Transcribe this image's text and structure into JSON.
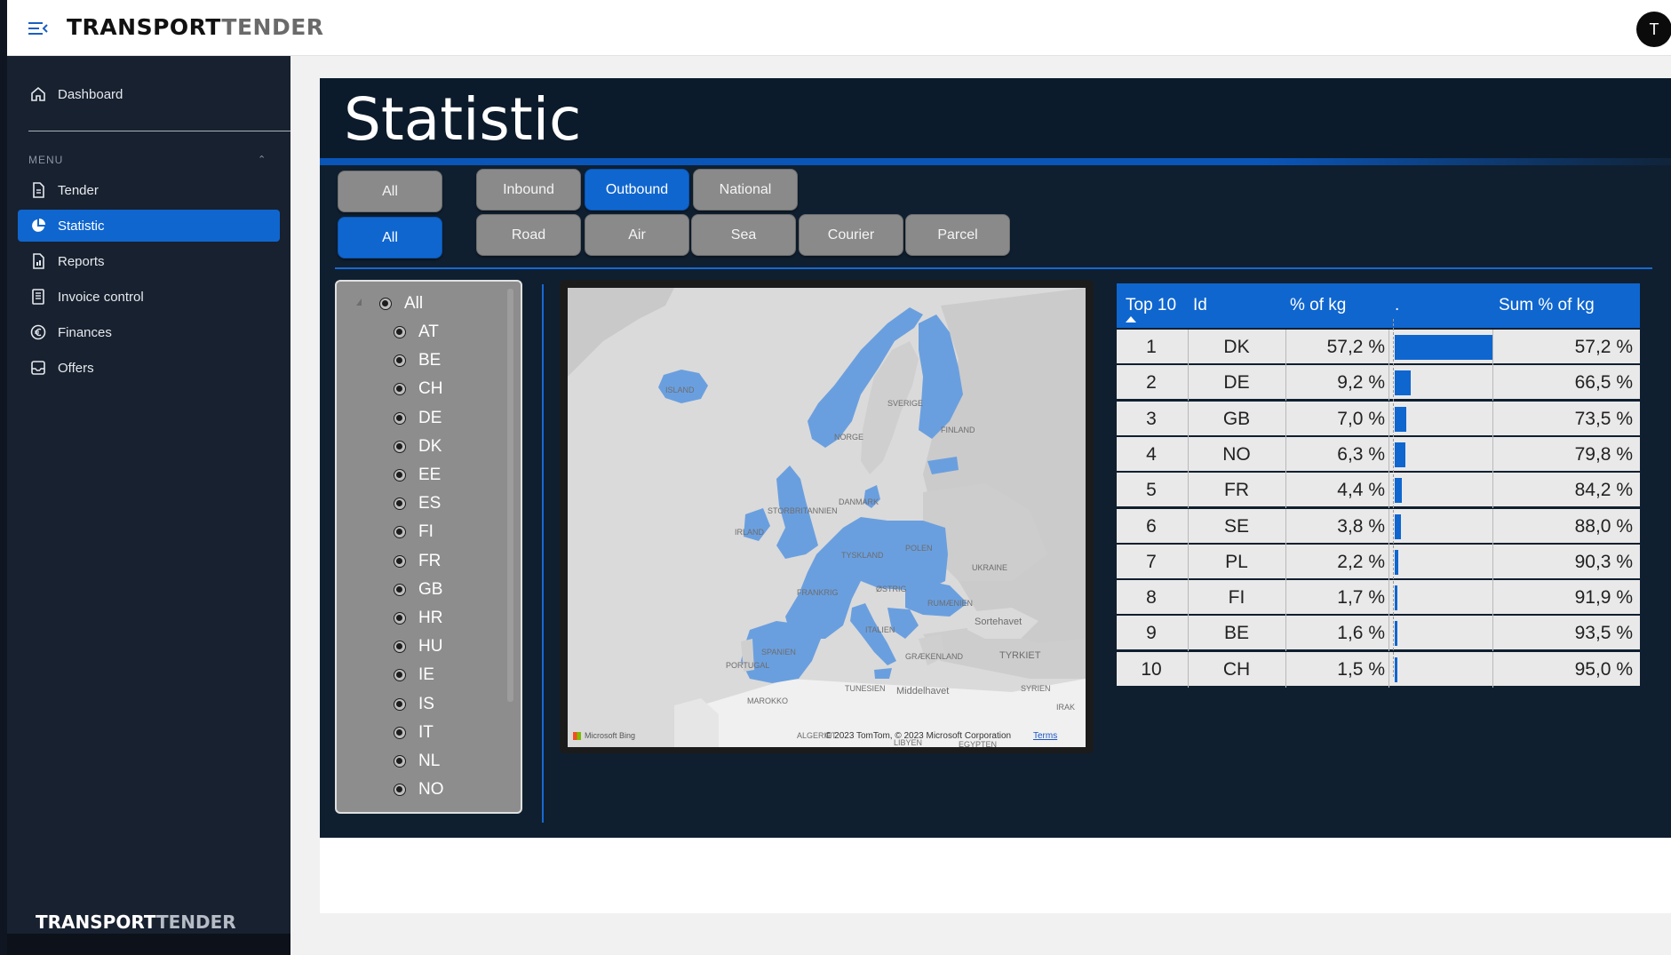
{
  "header": {
    "logo_part1": "TRANSPORT",
    "logo_part2": "TENDER",
    "avatar_initial": "T"
  },
  "sidebar": {
    "dashboard_label": "Dashboard",
    "menu_section_label": "MENU",
    "items": [
      {
        "label": "Tender",
        "icon": "document-icon"
      },
      {
        "label": "Statistic",
        "icon": "pie-chart-icon",
        "active": true
      },
      {
        "label": "Reports",
        "icon": "report-icon"
      },
      {
        "label": "Invoice control",
        "icon": "invoice-icon"
      },
      {
        "label": "Finances",
        "icon": "euro-icon"
      },
      {
        "label": "Offers",
        "icon": "inbox-icon"
      }
    ],
    "footer_logo_part1": "TRANSPORT",
    "footer_logo_part2": "TENDER"
  },
  "report": {
    "title": "Statistic",
    "filters_row1": {
      "all_label": "All",
      "buttons": [
        "Inbound",
        "Outbound",
        "National"
      ],
      "active": "Outbound"
    },
    "filters_row2": {
      "all_label": "All",
      "all_active": true,
      "buttons": [
        "Road",
        "Air",
        "Sea",
        "Courier",
        "Parcel"
      ]
    },
    "slicer": {
      "all_label": "All",
      "countries": [
        "AT",
        "BE",
        "CH",
        "DE",
        "DK",
        "EE",
        "ES",
        "FI",
        "FR",
        "GB",
        "HR",
        "HU",
        "IE",
        "IS",
        "IT",
        "NL",
        "NO"
      ]
    },
    "map": {
      "labels": [
        "ISLAND",
        "SVERIGE",
        "NORGE",
        "FINLAND",
        "STORBRITANNIEN",
        "DANMARK",
        "IRLAND",
        "POLEN",
        "TYSKLAND",
        "UKRAINE",
        "FRANKRIG",
        "ØSTRIG",
        "RUMÆNIEN",
        "Sortehavet",
        "ITALIEN",
        "SPANIEN",
        "PORTUGAL",
        "GRÆKENLAND",
        "TYRKIET",
        "SYRIEN",
        "TUNESIEN",
        "Middelhavet",
        "MAROKKO",
        "IRAK",
        "ALGERIET",
        "LIBYEN",
        "EGYPTEN"
      ],
      "bing_label": "Microsoft Bing",
      "copyright": "© 2023 TomTom, © 2023 Microsoft Corporation",
      "terms_label": "Terms",
      "highlight_color": "#6a9fdf"
    },
    "table": {
      "headers": {
        "top": "Top 10",
        "id": "Id",
        "pct": "% of kg",
        "bar": ".",
        "sum": "Sum % of kg"
      },
      "rows": [
        {
          "rank": "1",
          "id": "DK",
          "pct": "57,2 %",
          "pct_value": 57.2,
          "sum": "57,2 %"
        },
        {
          "rank": "2",
          "id": "DE",
          "pct": "9,2 %",
          "pct_value": 9.2,
          "sum": "66,5 %"
        },
        {
          "rank": "3",
          "id": "GB",
          "pct": "7,0 %",
          "pct_value": 7.0,
          "sum": "73,5 %"
        },
        {
          "rank": "4",
          "id": "NO",
          "pct": "6,3 %",
          "pct_value": 6.3,
          "sum": "79,8 %"
        },
        {
          "rank": "5",
          "id": "FR",
          "pct": "4,4 %",
          "pct_value": 4.4,
          "sum": "84,2 %"
        },
        {
          "rank": "6",
          "id": "SE",
          "pct": "3,8 %",
          "pct_value": 3.8,
          "sum": "88,0 %"
        },
        {
          "rank": "7",
          "id": "PL",
          "pct": "2,2 %",
          "pct_value": 2.2,
          "sum": "90,3 %"
        },
        {
          "rank": "8",
          "id": "FI",
          "pct": "1,7 %",
          "pct_value": 1.7,
          "sum": "91,9 %"
        },
        {
          "rank": "9",
          "id": "BE",
          "pct": "1,6 %",
          "pct_value": 1.6,
          "sum": "93,5 %"
        },
        {
          "rank": "10",
          "id": "CH",
          "pct": "1,5 %",
          "pct_value": 1.5,
          "sum": "95,0 %"
        }
      ]
    }
  },
  "colors": {
    "accent": "#0f66cf",
    "sidebar_bg": "#18212f",
    "report_bg": "#0f1f30"
  }
}
